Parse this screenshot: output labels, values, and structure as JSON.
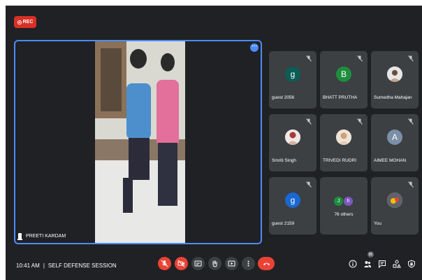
{
  "recording": {
    "label": "REC"
  },
  "presenter": {
    "name": "PREETI KARDAM"
  },
  "tiles": [
    {
      "name": "guest 2056",
      "initial": "g",
      "color": "#0b5d57"
    },
    {
      "name": "BHATT PRUTHA",
      "initial": "B",
      "color": "#1e8e3e"
    },
    {
      "name": "Sumedha Mahajan",
      "initial": "",
      "color": "#d8d8d8"
    },
    {
      "name": "Smriti Singh",
      "initial": "",
      "color": "#d8d8d8"
    },
    {
      "name": "TRIVEDI RUDRI",
      "initial": "",
      "color": "#d8d8d8"
    },
    {
      "name": "AIMEE MOHAN",
      "initial": "A",
      "color": "#7b8fa6"
    },
    {
      "name": "guest 2159",
      "initial": "g",
      "color": "#1967d2"
    }
  ],
  "others": {
    "label": "76 others",
    "initials": [
      "J",
      "h"
    ],
    "colors": [
      "#1e8e3e",
      "#7e57c2"
    ]
  },
  "self_tile": {
    "name": "You"
  },
  "footer": {
    "time": "10:41 AM",
    "meeting_title": "SELF DEFENSE SESSION",
    "participant_count": "85"
  }
}
